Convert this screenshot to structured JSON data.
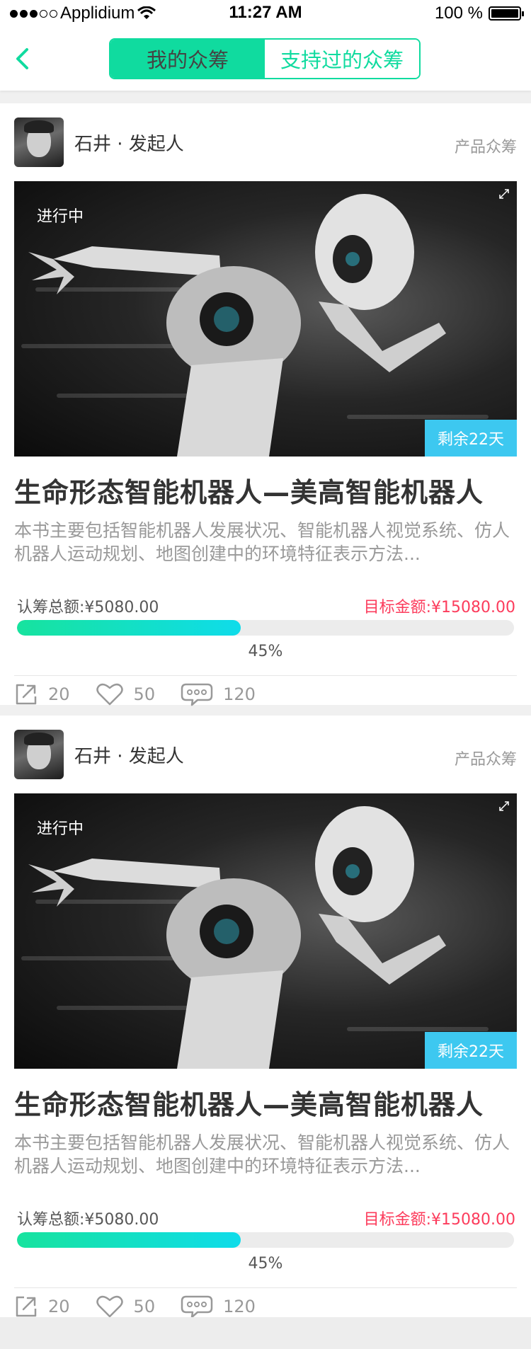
{
  "status_bar": {
    "carrier": "Applidium",
    "time": "11:27 AM",
    "battery": "100 %"
  },
  "nav": {
    "tabs": [
      {
        "label": "我的众筹",
        "active": true
      },
      {
        "label": "支持过的众筹",
        "active": false
      }
    ]
  },
  "colors": {
    "accent": "#10DB9F",
    "title": "#333333",
    "muted": "#999999",
    "body": "#575757",
    "target": "#FC3C5C",
    "remain_bg": "#3DC8F0"
  },
  "cards": [
    {
      "author": "石井 · 发起人",
      "category": "产品众筹",
      "status": "进行中",
      "remaining": "剩余22天",
      "title": "生命形态智能机器人—美高智能机器人",
      "description": "本书主要包括智能机器人发展状况、智能机器人视觉系统、仿人机器人运动规划、地图创建中的环境特征表示方法...",
      "raised": "认筹总额:¥5080.00",
      "target": "目标金额:¥15080.00",
      "progress": 0.45,
      "percent": "45%",
      "shares": "20",
      "likes": "50",
      "comments": "120"
    },
    {
      "author": "石井 · 发起人",
      "category": "产品众筹",
      "status": "进行中",
      "remaining": "剩余22天",
      "title": "生命形态智能机器人—美高智能机器人",
      "description": "本书主要包括智能机器人发展状况、智能机器人视觉系统、仿人机器人运动规划、地图创建中的环境特征表示方法...",
      "raised": "认筹总额:¥5080.00",
      "target": "目标金额:¥15080.00",
      "progress": 0.45,
      "percent": "45%",
      "shares": "20",
      "likes": "50",
      "comments": "120"
    }
  ]
}
